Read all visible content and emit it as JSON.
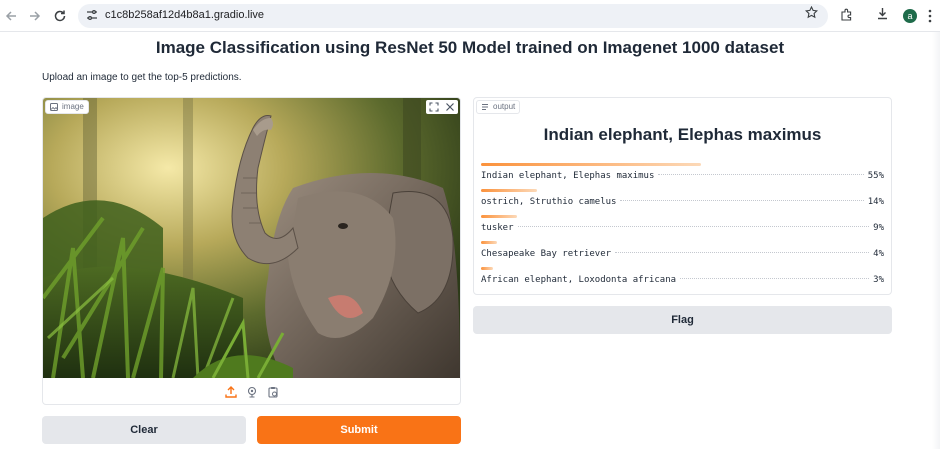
{
  "browser": {
    "url": "c1c8b258af12d4b8a1.gradio.live",
    "profile_initial": "a"
  },
  "page": {
    "title": "Image Classification using ResNet 50 Model trained on Imagenet 1000 dataset",
    "description": "Upload an image to get the top-5 predictions."
  },
  "input": {
    "label": "image",
    "image_subject": "Asian elephant raising its trunk in a sunlit jungle",
    "source_icons": [
      "upload-icon",
      "webcam-icon",
      "clipboard-icon"
    ]
  },
  "output": {
    "label": "output",
    "top_label": "Indian elephant, Elephas maximus",
    "confidences": [
      {
        "label": "Indian elephant, Elephas maximus",
        "percent": "55%",
        "value": 0.55
      },
      {
        "label": "ostrich, Struthio camelus",
        "percent": "14%",
        "value": 0.14
      },
      {
        "label": "tusker",
        "percent": "9%",
        "value": 0.09
      },
      {
        "label": "Chesapeake Bay retriever",
        "percent": "4%",
        "value": 0.04
      },
      {
        "label": "African elephant, Loxodonta africana",
        "percent": "3%",
        "value": 0.03
      }
    ]
  },
  "buttons": {
    "flag": "Flag",
    "clear": "Clear",
    "submit": "Submit"
  },
  "colors": {
    "accent": "#f97316",
    "secondary_button": "#e5e7eb"
  }
}
